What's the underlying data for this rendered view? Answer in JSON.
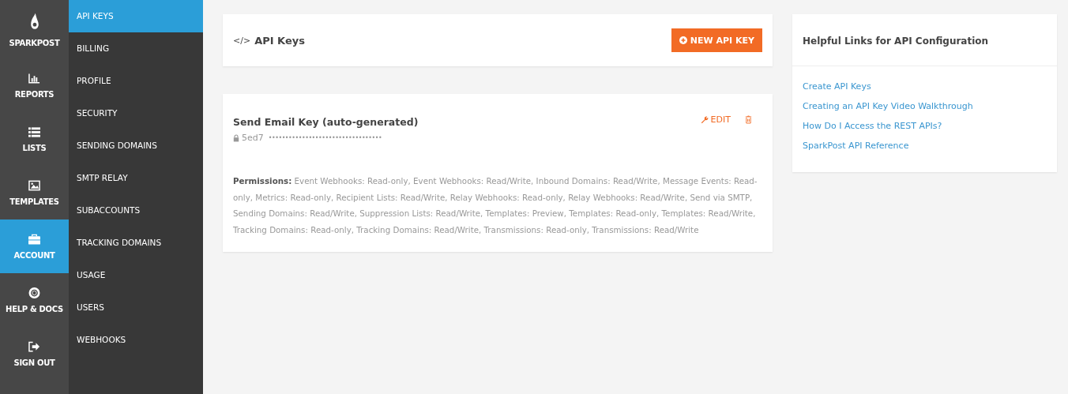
{
  "main_nav": [
    {
      "label": "SPARKPOST",
      "kind": "logo",
      "selected": false
    },
    {
      "label": "REPORTS",
      "kind": "chart",
      "selected": false
    },
    {
      "label": "LISTS",
      "kind": "list",
      "selected": false
    },
    {
      "label": "TEMPLATES",
      "kind": "image",
      "selected": false
    },
    {
      "label": "ACCOUNT",
      "kind": "briefcase",
      "selected": true
    },
    {
      "label": "HELP & DOCS",
      "kind": "lifebuoy",
      "selected": false
    },
    {
      "label": "SIGN OUT",
      "kind": "signout",
      "selected": false
    }
  ],
  "sub_nav": [
    {
      "label": "API KEYS",
      "selected": true
    },
    {
      "label": "BILLING",
      "selected": false
    },
    {
      "label": "PROFILE",
      "selected": false
    },
    {
      "label": "SECURITY",
      "selected": false
    },
    {
      "label": "SENDING DOMAINS",
      "selected": false
    },
    {
      "label": "SMTP RELAY",
      "selected": false
    },
    {
      "label": "SUBACCOUNTS",
      "selected": false
    },
    {
      "label": "TRACKING DOMAINS",
      "selected": false
    },
    {
      "label": "USAGE",
      "selected": false
    },
    {
      "label": "USERS",
      "selected": false
    },
    {
      "label": "WEBHOOKS",
      "selected": false
    }
  ],
  "header": {
    "code_glyph": "</>",
    "title": "API Keys",
    "button": "NEW API KEY"
  },
  "key_card": {
    "title": "Send Email Key (auto-generated)",
    "edit": "EDIT",
    "key_prefix": "5ed7",
    "key_mask": "••••••••••••••••••••••••••••••••••",
    "permissions": "**Permissions:** Event Webhooks: Read-only, Event Webhooks: Read/Write, Inbound Domains: Read/Write, Message Events: Read-only, Metrics: Read-only, Recipient Lists: Read/Write, Relay Webhooks: Read-only, Relay Webhooks: Read/Write, Send via SMTP, Sending Domains: Read/Write, Suppression Lists: Read/Write, Templates: Preview, Templates: Read-only, Templates: Read/Write, Tracking Domains: Read-only, Tracking Domains: Read/Write, Transmissions: Read-only, Transmissions: Read/Write"
  },
  "links_card": {
    "title": "Helpful Links for API Configuration",
    "links": [
      "Create API Keys",
      "Creating an API Key Video Walkthrough",
      "How Do I Access the REST APIs?",
      "SparkPost API Reference"
    ]
  }
}
